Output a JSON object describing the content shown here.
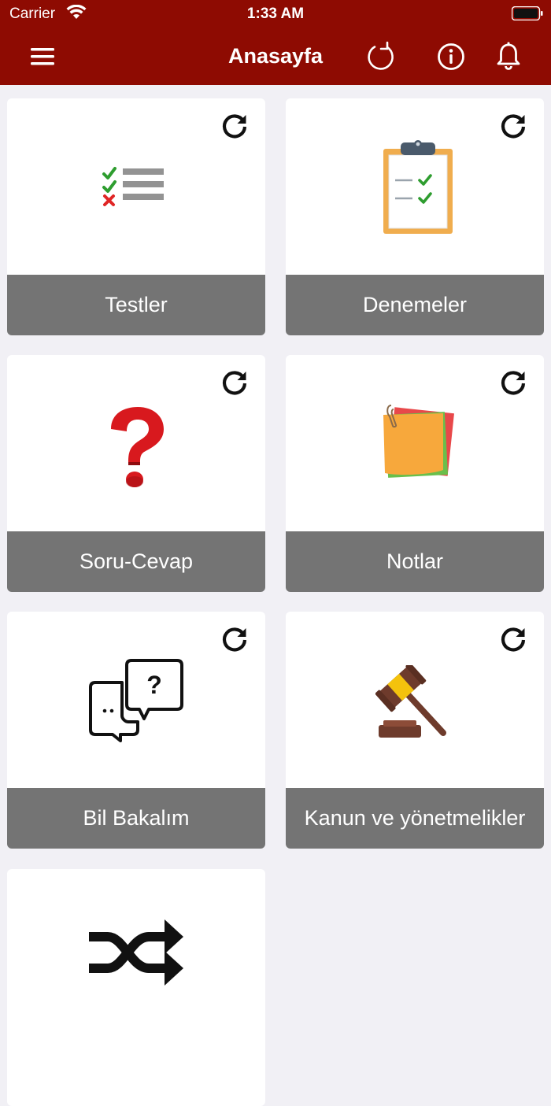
{
  "status_bar": {
    "carrier": "Carrier",
    "time": "1:33 AM"
  },
  "nav": {
    "title": "Anasayfa",
    "icons": [
      "menu-icon",
      "refresh-icon",
      "info-icon",
      "bell-icon"
    ]
  },
  "colors": {
    "header": "#8e0b02",
    "label_bg": "#747474",
    "page_bg": "#f1f0f5"
  },
  "cards": [
    {
      "label": "Testler",
      "icon": "checklist-icon"
    },
    {
      "label": "Denemeler",
      "icon": "clipboard-icon"
    },
    {
      "label": "Soru-Cevap",
      "icon": "question-mark-icon"
    },
    {
      "label": "Notlar",
      "icon": "sticky-notes-icon"
    },
    {
      "label": "Bil Bakalım",
      "icon": "chat-bubbles-icon"
    },
    {
      "label": "Kanun ve yönetmelikler",
      "icon": "gavel-icon"
    },
    {
      "label": "",
      "icon": "shuffle-icon"
    }
  ]
}
